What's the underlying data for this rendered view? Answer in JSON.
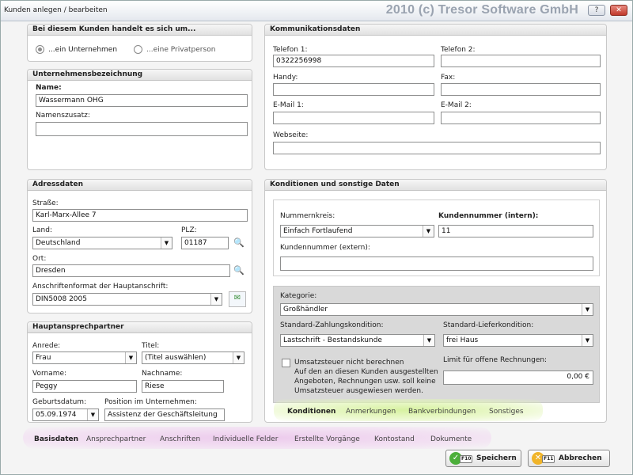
{
  "window": {
    "title": "Kunden anlegen / bearbeiten",
    "brand": "2010 (c) Tresor Software GmbH",
    "help_label": "?",
    "close_label": "✕"
  },
  "kundentyp": {
    "header": "Bei diesem Kunden handelt es sich um...",
    "option_company": "...ein Unternehmen",
    "option_private": "...eine Privatperson",
    "selected": "company"
  },
  "unternehmen": {
    "header": "Unternehmensbezeichnung",
    "name_label": "Name:",
    "name_value": "Wassermann OHG",
    "zusatz_label": "Namenszusatz:",
    "zusatz_value": ""
  },
  "kommunikation": {
    "header": "Kommunikationsdaten",
    "telefon1_label": "Telefon 1:",
    "telefon1_value": "0322256998",
    "telefon2_label": "Telefon 2:",
    "handy_label": "Handy:",
    "fax_label": "Fax:",
    "email1_label": "E-Mail 1:",
    "email2_label": "E-Mail 2:",
    "webseite_label": "Webseite:"
  },
  "adresse": {
    "header": "Adressdaten",
    "strasse_label": "Straße:",
    "strasse_value": "Karl-Marx-Allee 7",
    "land_label": "Land:",
    "land_value": "Deutschland",
    "plz_label": "PLZ:",
    "plz_value": "01187",
    "ort_label": "Ort:",
    "ort_value": "Dresden",
    "format_label": "Anschriftenformat der Hauptanschrift:",
    "format_value": "DIN5008 2005"
  },
  "ansprechpartner": {
    "header": "Hauptansprechpartner",
    "anrede_label": "Anrede:",
    "anrede_value": "Frau",
    "titel_label": "Titel:",
    "titel_value": "(Titel auswählen)",
    "vorname_label": "Vorname:",
    "vorname_value": "Peggy",
    "nachname_label": "Nachname:",
    "nachname_value": "Riese",
    "geburt_label": "Geburtsdatum:",
    "geburt_value": "05.09.1974",
    "position_label": "Position im Unternehmen:",
    "position_value": "Assistenz der Geschäftsleitung"
  },
  "konditionen": {
    "header": "Konditionen und sonstige Daten",
    "nummernkreis_label": "Nummernkreis:",
    "nummernkreis_value": "Einfach Fortlaufend",
    "kundennr_label": "Kundennummer (intern):",
    "kundennr_value": "11",
    "kundennr_ext_label": "Kundennummer (extern):",
    "kundennr_ext_value": "",
    "kategorie_label": "Kategorie:",
    "kategorie_value": "Großhändler",
    "zahlung_label": "Standard-Zahlungskondition:",
    "zahlung_value": "Lastschrift - Bestandskunde",
    "liefer_label": "Standard-Lieferkondition:",
    "liefer_value": "frei Haus",
    "ust_label": "Umsatzsteuer nicht berechnen",
    "ust_desc_1": "Auf den an diesen Kunden ausgestellten",
    "ust_desc_2": "Angeboten, Rechnungen usw. soll keine",
    "ust_desc_3": "Umsatzsteuer ausgewiesen werden.",
    "limit_label": "Limit für offene Rechnungen:",
    "limit_value": "0,00 €"
  },
  "inner_tabs": [
    "Konditionen",
    "Anmerkungen",
    "Bankverbindungen",
    "Sonstiges"
  ],
  "main_tabs": [
    "Basisdaten",
    "Ansprechpartner",
    "Anschriften",
    "Individuelle Felder",
    "Erstellte Vorgänge",
    "Kontostand",
    "Dokumente"
  ],
  "actions": {
    "save_key": "F10",
    "save_label": "Speichern",
    "cancel_key": "F11",
    "cancel_label": "Abbrechen"
  },
  "colors": {
    "active_tab_glow": "#d4f09a",
    "main_tab_glow": "#ecc8ec",
    "save_icon": "#4caf3a",
    "cancel_icon": "#f0b429"
  }
}
